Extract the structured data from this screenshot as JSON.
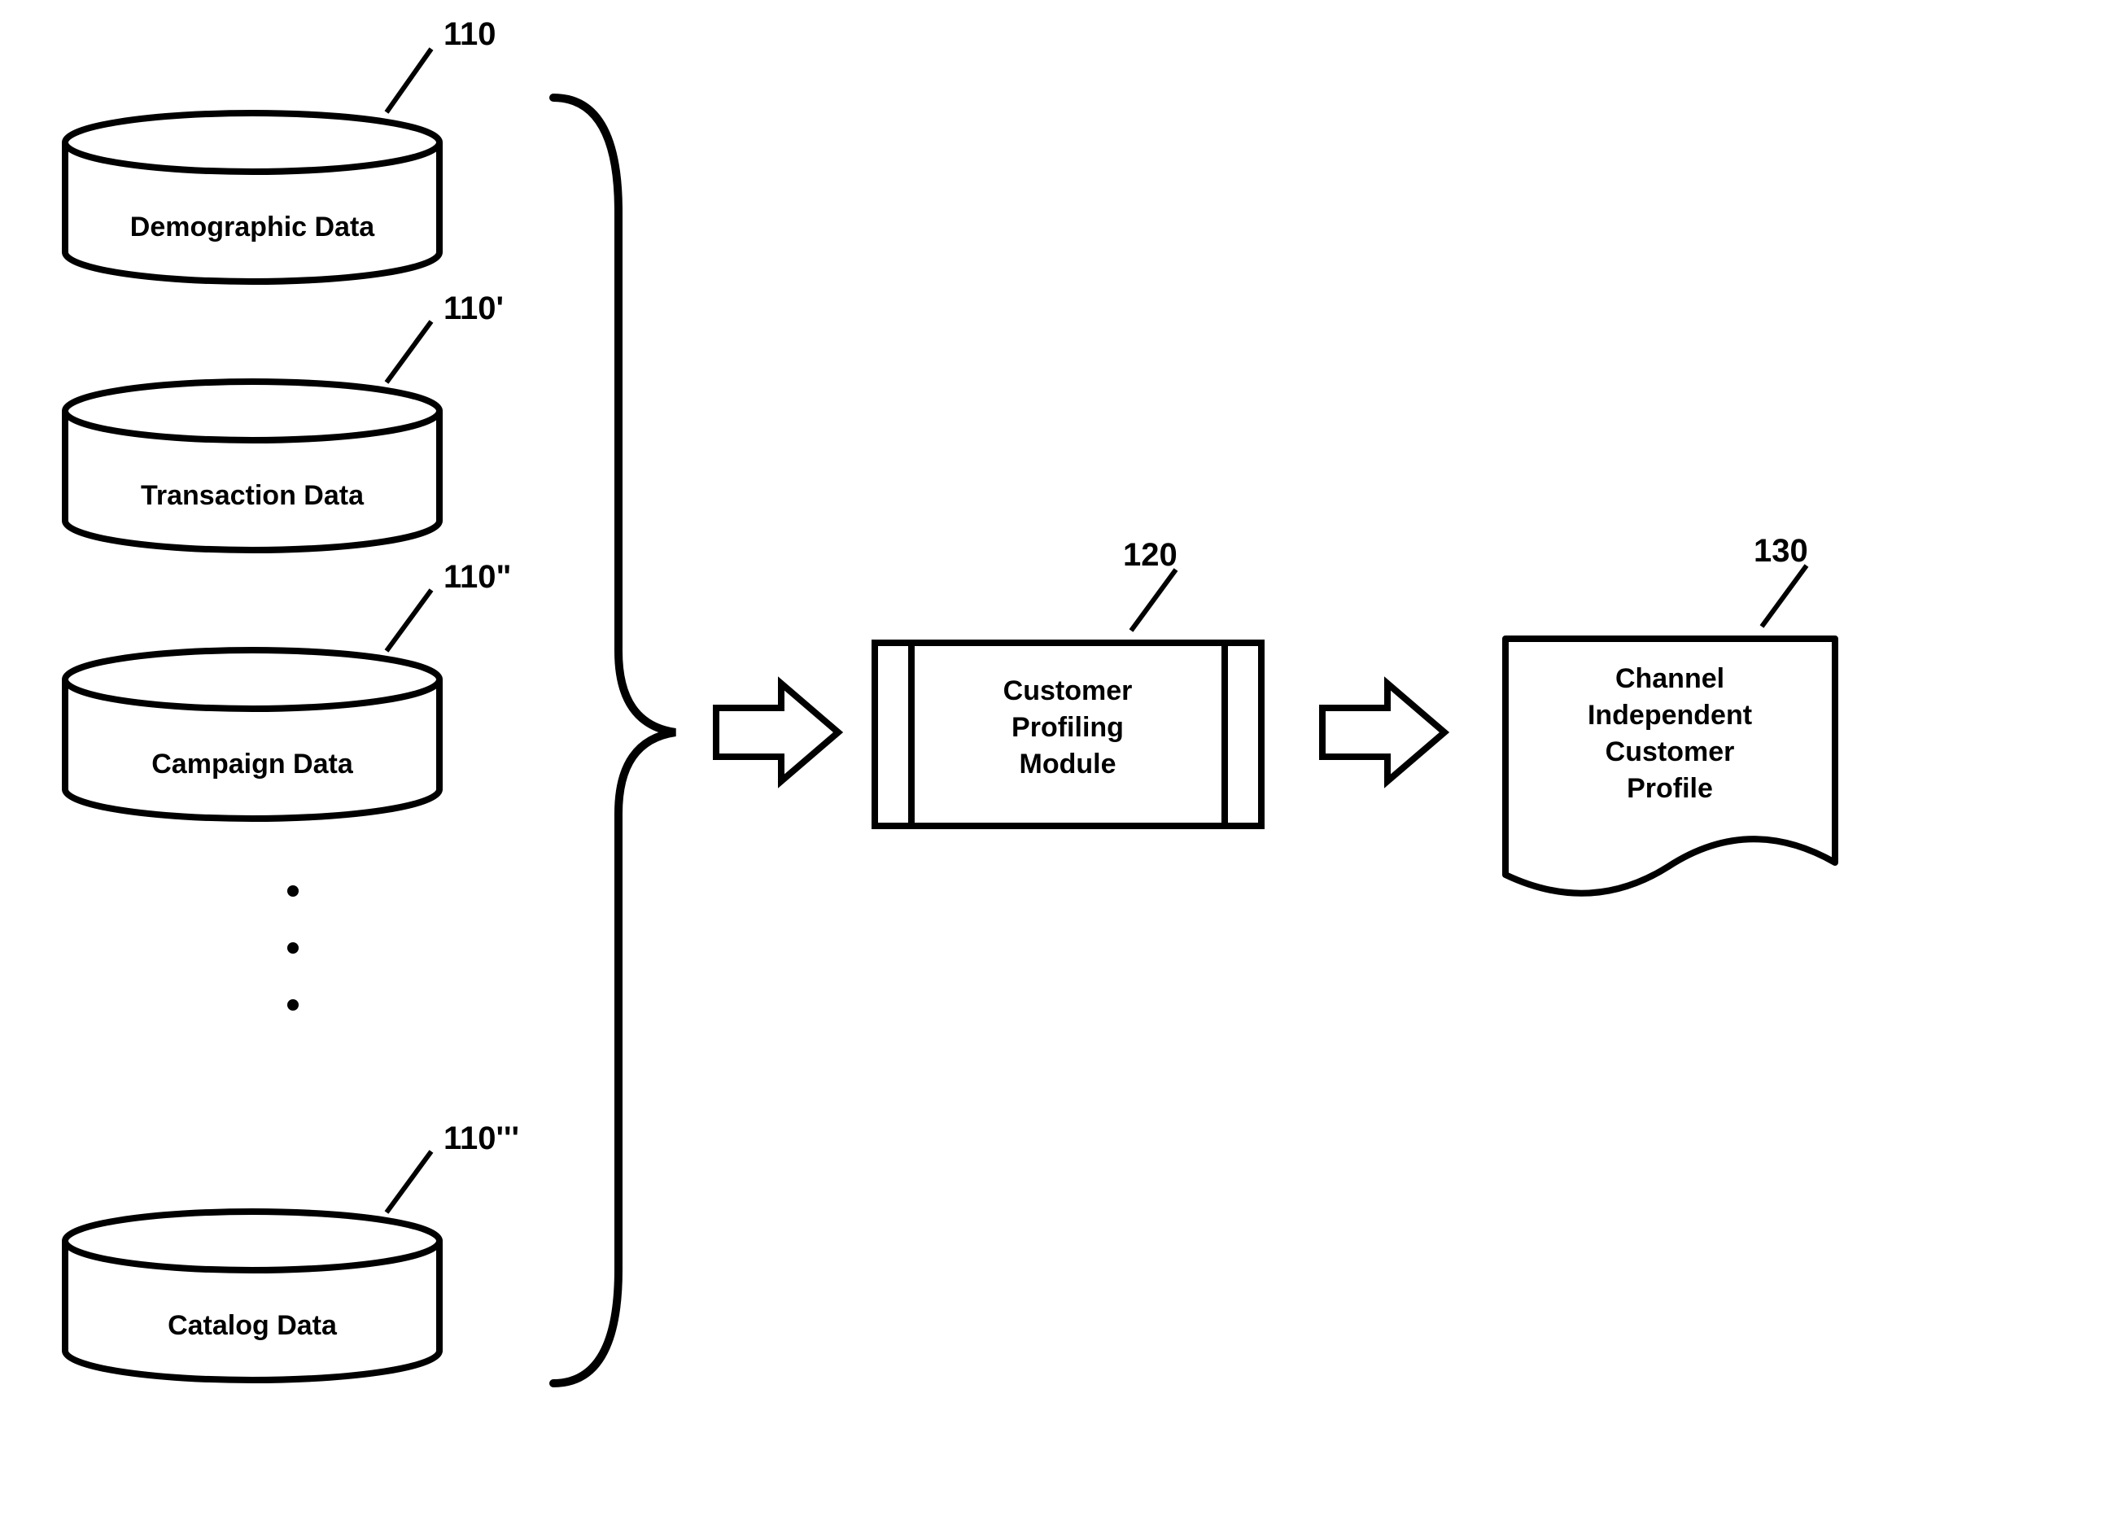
{
  "databases": [
    {
      "ref": "110",
      "label": "Demographic Data"
    },
    {
      "ref": "110'",
      "label": "Transaction Data"
    },
    {
      "ref": "110\"",
      "label": "Campaign Data"
    },
    {
      "ref": "110'''",
      "label": "Catalog Data"
    }
  ],
  "module": {
    "ref": "120",
    "label_line1": "Customer",
    "label_line2": "Profiling",
    "label_line3": "Module"
  },
  "output": {
    "ref": "130",
    "label_line1": "Channel",
    "label_line2": "Independent",
    "label_line3": "Customer",
    "label_line4": "Profile"
  }
}
